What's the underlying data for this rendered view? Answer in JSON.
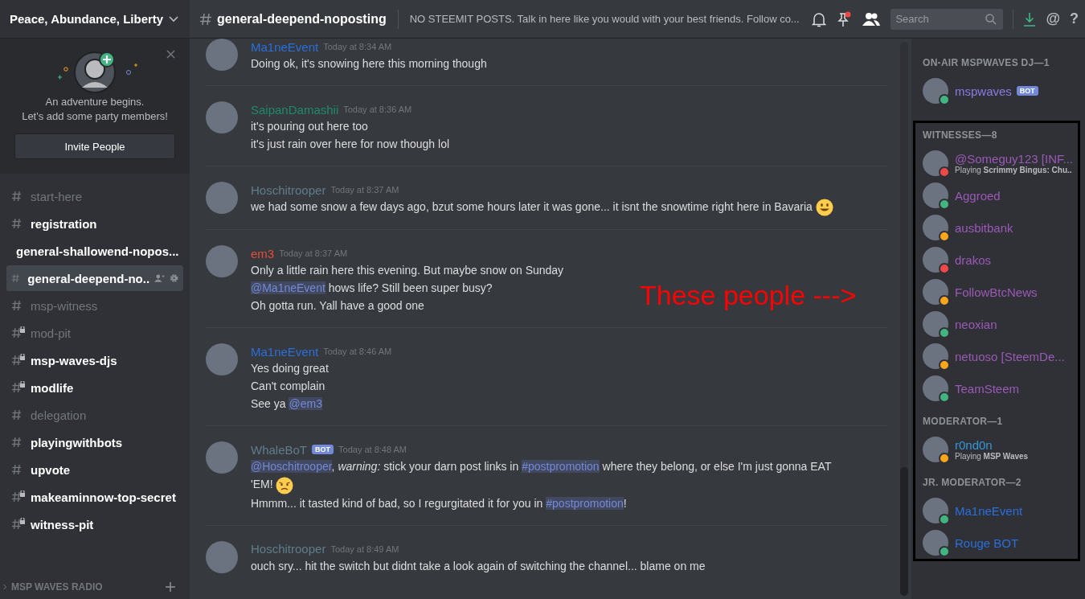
{
  "server": {
    "name": "Peace, Abundance, Liberty"
  },
  "invite_card": {
    "title": "An adventure begins.",
    "subtitle": "Let's add some party members!",
    "button": "Invite People"
  },
  "channels": [
    {
      "name": "start-here",
      "kind": "text",
      "unread": false,
      "selected": false
    },
    {
      "name": "registration",
      "kind": "text",
      "unread": true,
      "selected": false
    },
    {
      "name": "general-shallowend-nopos...",
      "kind": "text",
      "unread": true,
      "selected": false
    },
    {
      "name": "general-deepend-no..",
      "kind": "text",
      "unread": true,
      "selected": true
    },
    {
      "name": "msp-witness",
      "kind": "text",
      "unread": false,
      "selected": false
    },
    {
      "name": "mod-pit",
      "kind": "locked",
      "unread": false,
      "selected": false
    },
    {
      "name": "msp-waves-djs",
      "kind": "locked",
      "unread": true,
      "selected": false
    },
    {
      "name": "modlife",
      "kind": "locked",
      "unread": true,
      "selected": false
    },
    {
      "name": "delegation",
      "kind": "text",
      "unread": false,
      "selected": false
    },
    {
      "name": "playingwithbots",
      "kind": "text",
      "unread": true,
      "selected": false
    },
    {
      "name": "upvote",
      "kind": "text",
      "unread": true,
      "selected": false
    },
    {
      "name": "makeaminnow-top-secret",
      "kind": "locked",
      "unread": true,
      "selected": false
    },
    {
      "name": "witness-pit",
      "kind": "locked",
      "unread": true,
      "selected": false
    }
  ],
  "category": {
    "name": "MSP WAVES RADIO",
    "expanded": false
  },
  "header": {
    "channel": "general-deepend-noposting",
    "topic": "NO STEEMIT POSTS. Talk in here like you would with your best friends. Follow co...",
    "search_placeholder": "Search",
    "glyphs": [
      "@",
      "?"
    ]
  },
  "messages": [
    {
      "author": "Ma1neEvent",
      "color": "#2a6fdb",
      "time": "Today at 8:34 AM",
      "lines": [
        [
          {
            "kind": "text",
            "text": "Doing ok,  it's snowing here this  morning though"
          }
        ]
      ]
    },
    {
      "author": "SaipanDamashii",
      "color": "#1f8b6c",
      "time": "Today at 8:36 AM",
      "lines": [
        [
          {
            "kind": "text",
            "text": "it's pouring out here too"
          }
        ],
        [
          {
            "kind": "text",
            "text": "it's just rain over here for now though lol"
          }
        ]
      ]
    },
    {
      "author": "Hoschitrooper",
      "color": "#607d8b",
      "time": "Today at 8:37 AM",
      "lines": [
        [
          {
            "kind": "text",
            "text": "we had some snow a few days ago, bzut some hours later it was gone...  it isnt the snowtime right here in Bavaria "
          },
          {
            "kind": "smile"
          }
        ]
      ]
    },
    {
      "author": "em3",
      "color": "#e74c3c",
      "time": "Today at 8:37 AM",
      "lines": [
        [
          {
            "kind": "text",
            "text": "Only a little rain here this evening.  But maybe snow on Sunday"
          }
        ],
        [
          {
            "kind": "mention",
            "text": "@Ma1neEvent"
          },
          {
            "kind": "text",
            "text": " hows life? Still been super busy?"
          }
        ],
        [
          {
            "kind": "text",
            "text": "Oh gotta run.  Yall have a good one"
          }
        ]
      ]
    },
    {
      "author": "Ma1neEvent",
      "color": "#2a6fdb",
      "time": "Today at 8:46 AM",
      "lines": [
        [
          {
            "kind": "text",
            "text": "Yes doing great"
          }
        ],
        [
          {
            "kind": "text",
            "text": "Can't  complain"
          }
        ],
        [
          {
            "kind": "text",
            "text": "See ya "
          },
          {
            "kind": "mention",
            "text": "@em3"
          }
        ]
      ]
    },
    {
      "author": "WhaleBoT",
      "color": "#607d8b",
      "badge": "BOT",
      "time": "Today at 8:48 AM",
      "lines": [
        [
          {
            "kind": "mention",
            "text": "@Hoschitrooper"
          },
          {
            "kind": "text",
            "text": ", *warning:* stick your darn post links in "
          },
          {
            "kind": "mention",
            "text": "#postpromotion"
          },
          {
            "kind": "text",
            "text": " where they belong, or else I'm just gonna EAT 'EM! "
          },
          {
            "kind": "angry"
          }
        ],
        [
          {
            "kind": "text",
            "text": "Hmmm... it tasted kind of bad, so I regurgitated it for you in "
          },
          {
            "kind": "mention",
            "text": "#postpromotion"
          },
          {
            "kind": "text",
            "text": "!"
          }
        ]
      ]
    },
    {
      "author": "Hoschitrooper",
      "color": "#607d8b",
      "time": "Today at 8:49 AM",
      "lines": [
        [
          {
            "kind": "text",
            "text": "ouch sry... hit the switch but  didnt take a look again of switching the channel...  blame on me"
          }
        ]
      ]
    }
  ],
  "annotation": {
    "text": "These people --->"
  },
  "member_groups": [
    {
      "title": "ON-AIR MSPWAVES DJ—1",
      "color": "#8c7ae6",
      "highlighted": false,
      "members": [
        {
          "name": "mspwaves",
          "color": "#43b581",
          "badge": "BOT"
        }
      ]
    },
    {
      "title": "WITNESSES—8",
      "color": "#9b59b6",
      "highlighted": true,
      "members": [
        {
          "name": "@Someguy123 [INF...",
          "color": "#f04747",
          "activity": "Playing **Scrimmy Bingus: Chu..**"
        },
        {
          "name": "Aggroed",
          "color": "#43b581"
        },
        {
          "name": "ausbitbank",
          "color": "#faa61a"
        },
        {
          "name": "drakos",
          "color": "#f04747"
        },
        {
          "name": "FollowBtcNews",
          "color": "#faa61a"
        },
        {
          "name": "neoxian",
          "color": "#43b581"
        },
        {
          "name": "netuoso [SteemDe...",
          "color": "#faa61a"
        },
        {
          "name": "TeamSteem",
          "color": "#43b581"
        }
      ]
    },
    {
      "title": "MODERATOR—1",
      "color": "#3498db",
      "highlighted": true,
      "members": [
        {
          "name": "r0nd0n",
          "color": "#faa61a",
          "activity": "Playing **MSP Waves**"
        }
      ]
    },
    {
      "title": "JR. MODERATOR—2",
      "color": "#2a6fdb",
      "highlighted": true,
      "members": [
        {
          "name": "Ma1neEvent",
          "color": "#43b581"
        },
        {
          "name": "Rouge BOT",
          "color": "#43b581"
        }
      ]
    }
  ]
}
